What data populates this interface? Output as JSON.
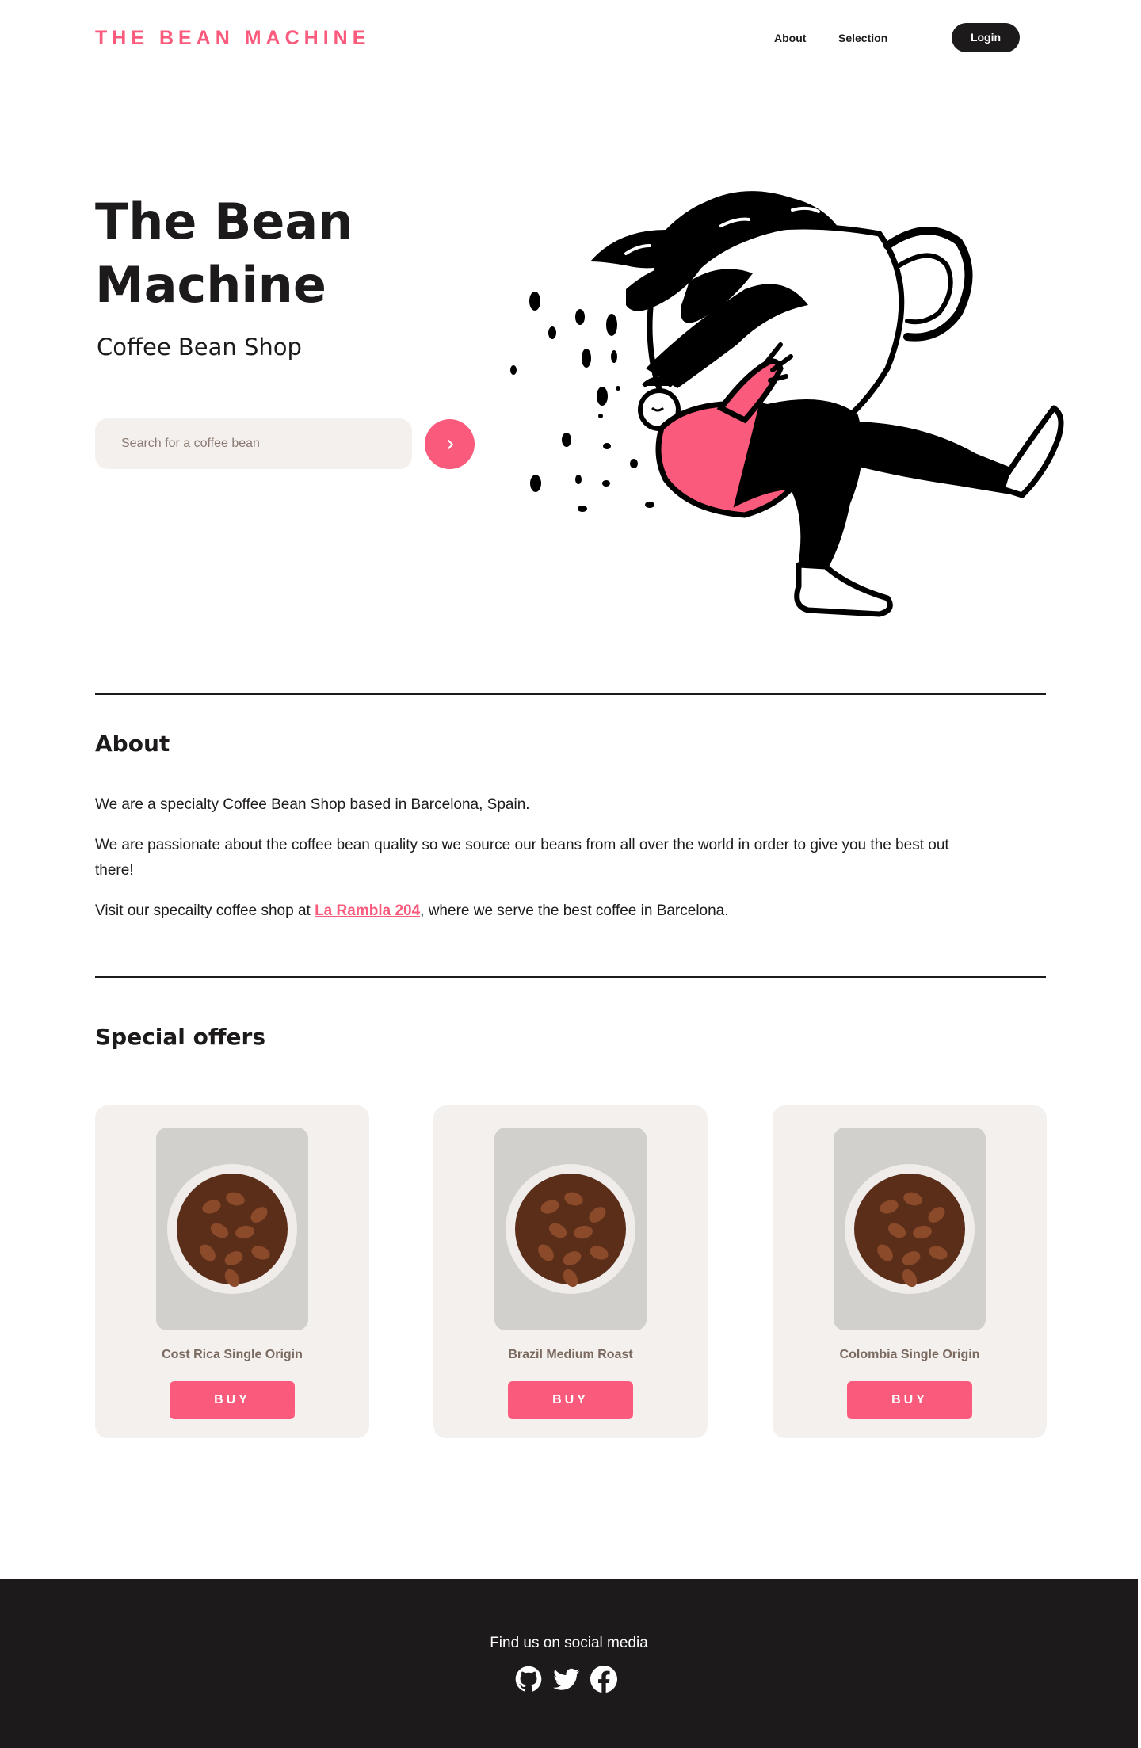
{
  "header": {
    "logo": "THE BEAN MACHINE",
    "nav": {
      "about": "About",
      "selection": "Selection"
    },
    "login_label": "Login"
  },
  "hero": {
    "title": "The Bean Machine",
    "subtitle": "Coffee Bean Shop",
    "search_placeholder": "Search for a coffee bean",
    "search_button_icon": "chevron-right-icon"
  },
  "about": {
    "title": "About",
    "p1": "We are a specialty Coffee Bean Shop based in Barcelona, Spain.",
    "p2": "We are passionate about the coffee bean quality so we source our beans from all over the world in order to give you the best out there!",
    "p3_before": "Visit our specailty coffee shop at ",
    "p3_link": "La Rambla 204",
    "p3_after": ", where we serve the best coffee in Barcelona."
  },
  "offers": {
    "title": "Special offers",
    "items": [
      {
        "name": "Cost Rica Single Origin",
        "buy_label": "BUY"
      },
      {
        "name": "Brazil Medium Roast",
        "buy_label": "BUY"
      },
      {
        "name": "Colombia Single Origin",
        "buy_label": "BUY"
      }
    ]
  },
  "footer": {
    "text": "Find us on social media",
    "icons": [
      "github-icon",
      "twitter-icon",
      "facebook-icon"
    ]
  },
  "colors": {
    "accent": "#fa5a7c",
    "dark": "#1c1a1b",
    "card_bg": "#f4f0ed",
    "card_text": "#7a6a60"
  }
}
